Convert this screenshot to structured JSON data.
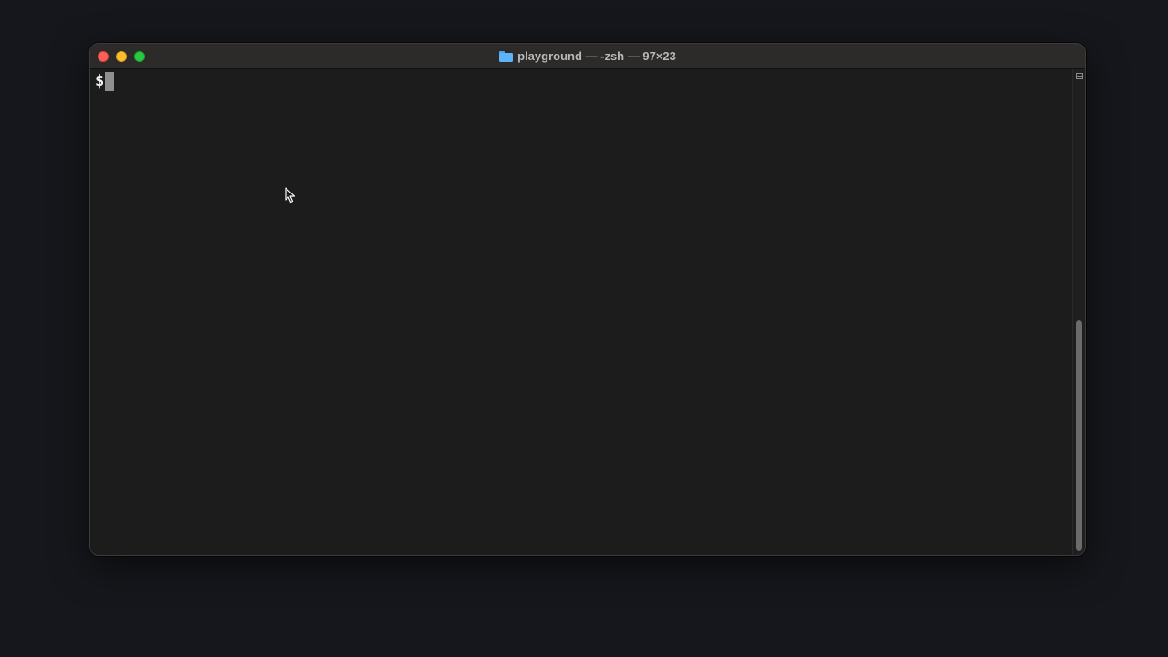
{
  "window": {
    "title": "playground — -zsh — 97×23",
    "folder_icon": "folder-icon"
  },
  "terminal": {
    "prompt": "$"
  },
  "colors": {
    "desktop_background": "#15171c",
    "terminal_background": "#1c1c1c",
    "titlebar_background": "#2c2b29",
    "close": "#fe5f57",
    "minimize": "#febc2e",
    "zoom": "#28c840"
  }
}
